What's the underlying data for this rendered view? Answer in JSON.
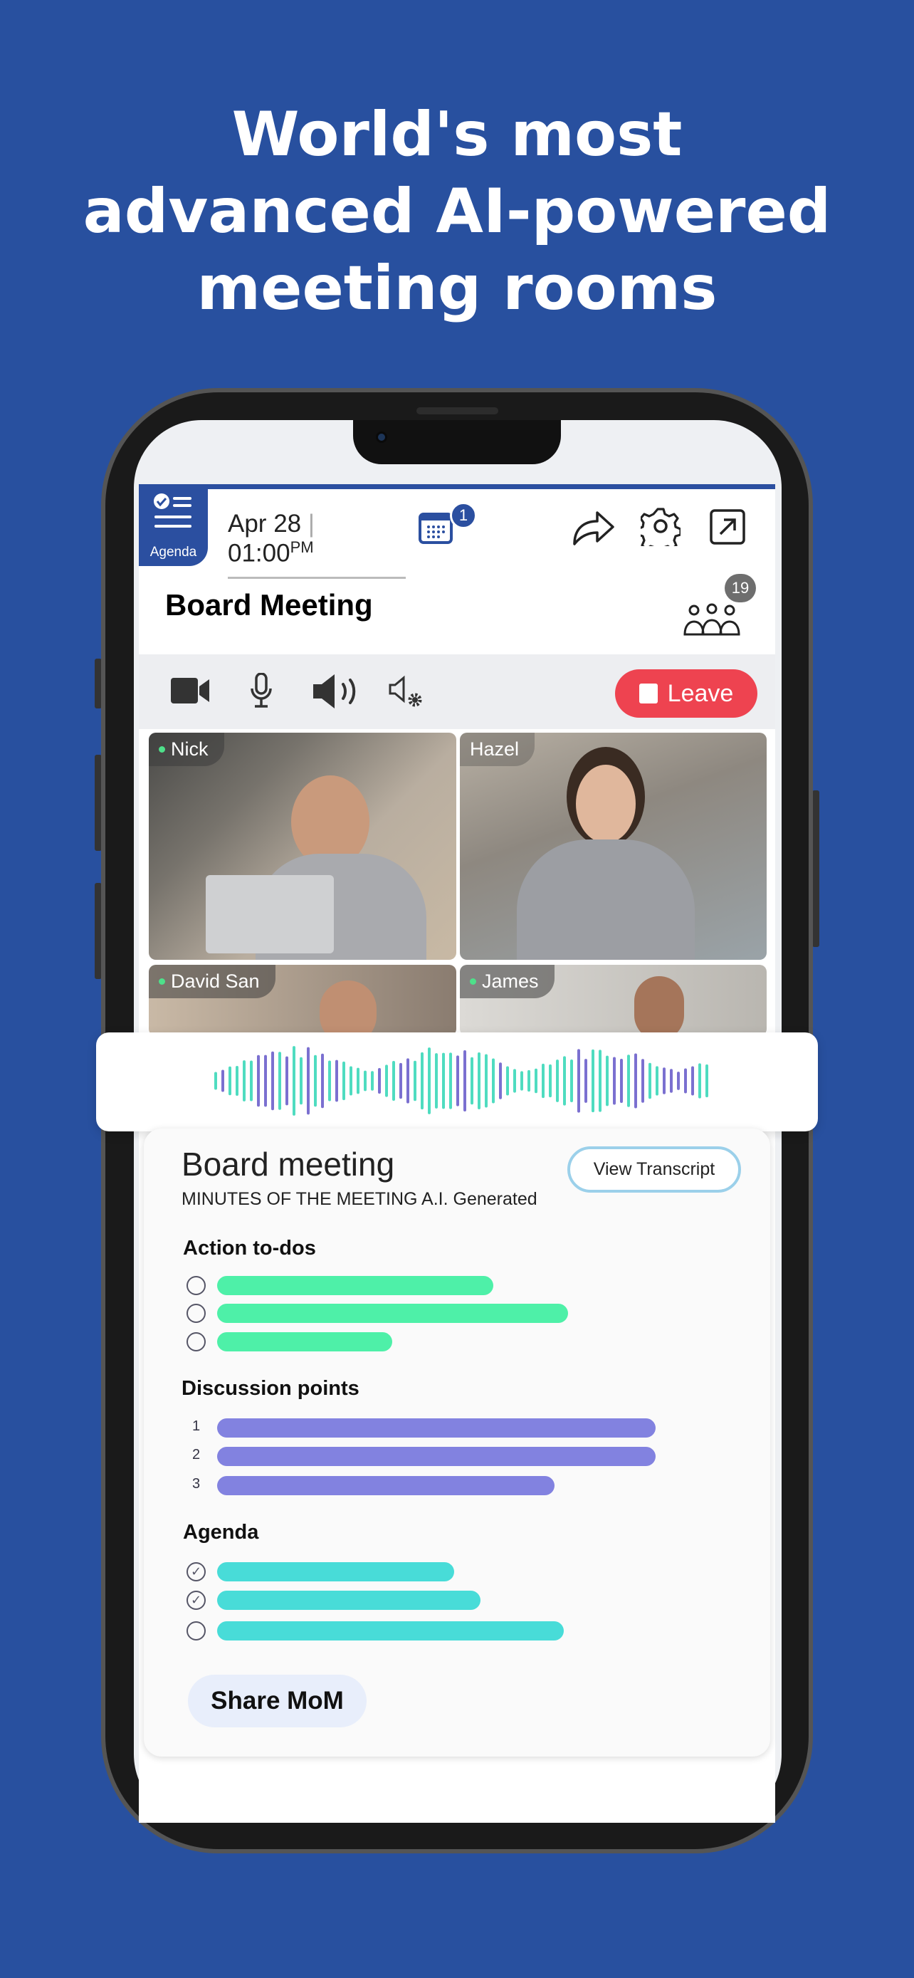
{
  "headline": [
    "World's most",
    "advanced AI-powered",
    "meeting rooms"
  ],
  "colors": {
    "background": "#28509f",
    "brand": "#2b4fa0",
    "leave": "#ee4350",
    "todo_bar": "#4ef0a8",
    "discussion_bar": "#8282e0",
    "agenda_bar": "#48dcd8",
    "wave_teal": "#4fdcc0",
    "wave_purple": "#7b70d0"
  },
  "header": {
    "agenda_label": "Agenda",
    "date": "Apr 28",
    "time": "01:00",
    "ampm": "PM",
    "calendar_badge": "1",
    "icons": [
      "share-icon",
      "settings-icon",
      "external-link-icon"
    ]
  },
  "meeting": {
    "title": "Board Meeting",
    "participants_count": "19"
  },
  "controls": {
    "icons": [
      "video-icon",
      "mic-icon",
      "speaker-icon",
      "audio-settings-icon"
    ],
    "leave_label": "Leave"
  },
  "participants": [
    {
      "name": "Nick"
    },
    {
      "name": "Hazel"
    },
    {
      "name": "David San"
    },
    {
      "name": "James"
    }
  ],
  "mom": {
    "title": "Board meeting",
    "subtitle": "MINUTES OF THE MEETING A.I. Generated",
    "view_transcript": "View Transcript",
    "sections": {
      "todos": {
        "label": "Action to-dos",
        "items": [
          {
            "checked": false,
            "fill": 0.63
          },
          {
            "checked": false,
            "fill": 0.8
          },
          {
            "checked": false,
            "fill": 0.4
          }
        ]
      },
      "discussion": {
        "label": "Discussion points",
        "items": [
          {
            "num": "1",
            "fill": 1.0
          },
          {
            "num": "2",
            "fill": 1.0
          },
          {
            "num": "3",
            "fill": 0.77
          }
        ]
      },
      "agenda": {
        "label": "Agenda",
        "items": [
          {
            "checked": true,
            "fill": 0.54
          },
          {
            "checked": true,
            "fill": 0.6
          },
          {
            "checked": false,
            "fill": 0.79
          }
        ]
      }
    },
    "share_label": "Share MoM"
  }
}
